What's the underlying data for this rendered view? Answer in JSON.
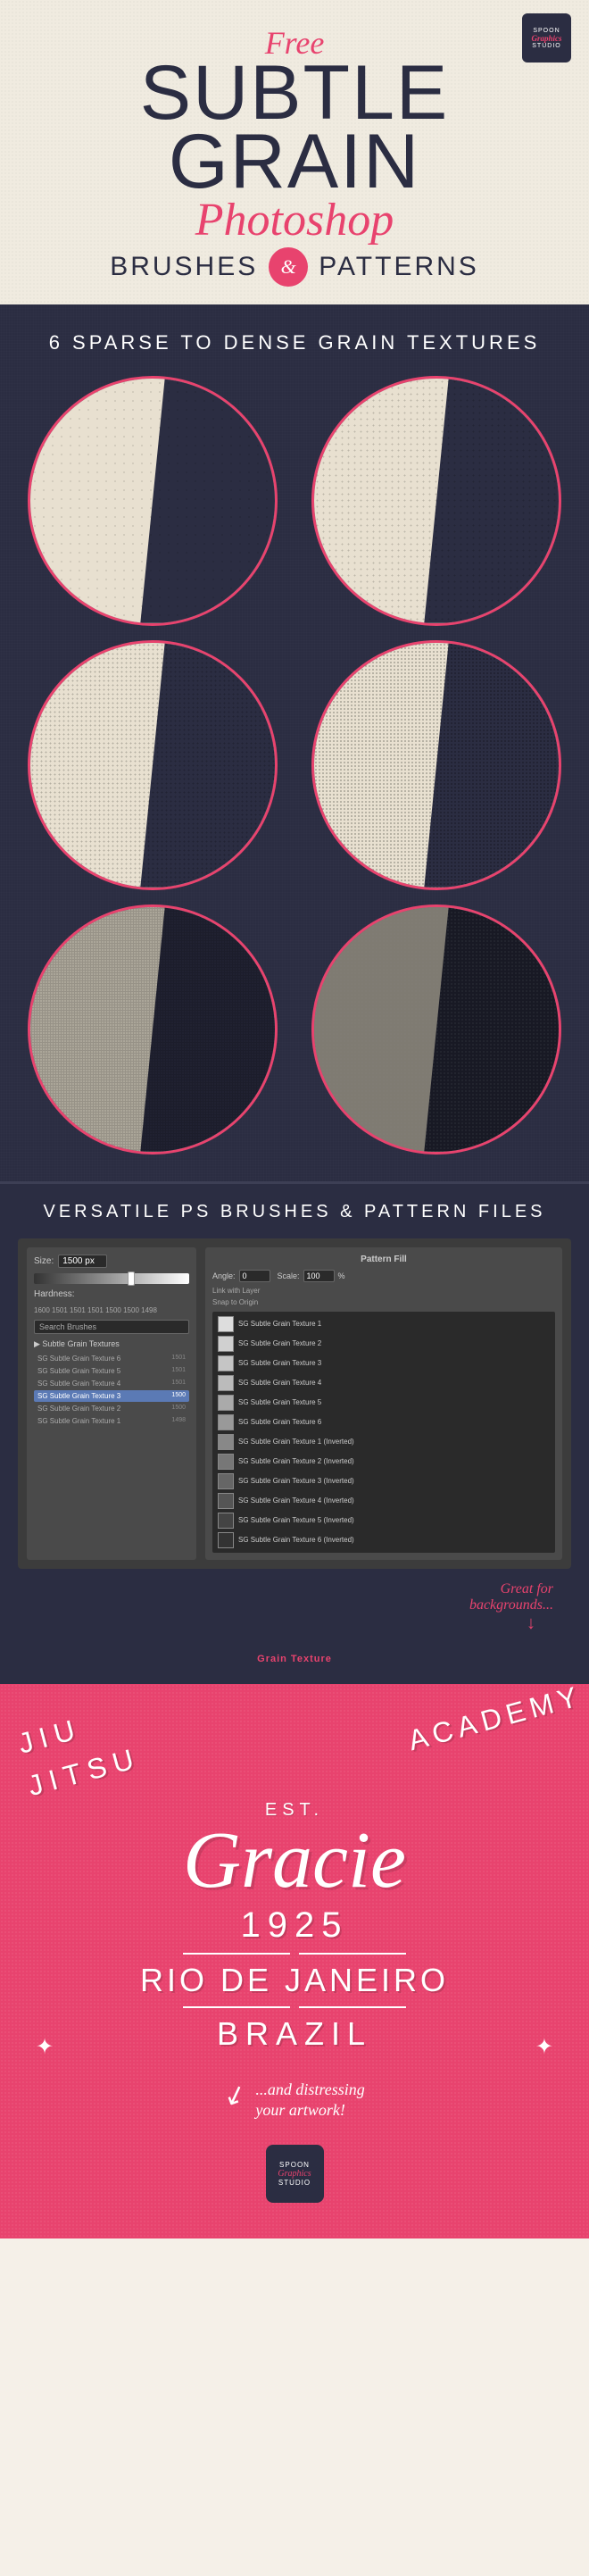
{
  "header": {
    "free_label": "Free",
    "subtle_label": "SUBTLE",
    "grain_label": "GRAIN",
    "photoshop_label": "Photoshop",
    "brushes_label": "BRUSHES",
    "ampersand_label": "&",
    "patterns_label": "PATTERNS",
    "spoon_line1": "SPOON",
    "spoon_line2": "Graphics",
    "spoon_line3": "STUDIO"
  },
  "grain_section": {
    "title": "6 SPARSE TO DENSE GRAIN TEXTURES"
  },
  "versatile_section": {
    "title": "VERSATILE PS BRUSHES & PATTERN FILES",
    "size_label": "Size:",
    "size_value": "1500 px",
    "hardness_label": "Hardness:",
    "numbers_row": "1600 1501 1501 1501 1500 1500 1498",
    "search_placeholder": "Search Brushes",
    "folder_label": "▶ Subtle Grain Textures",
    "brushes": [
      "SG Subtle Grain Texture 6",
      "SG Subtle Grain Texture 5",
      "SG Subtle Grain Texture 4",
      "SG Subtle Grain Texture 3",
      "SG Subtle Grain Texture 2",
      "SG Subtle Grain Texture 1"
    ],
    "brush_sizes": [
      "1501",
      "1501",
      "1501",
      "1500",
      "1500",
      "1498"
    ],
    "pattern_fill_title": "Pattern Fill",
    "angle_label": "Angle:",
    "angle_value": "0",
    "scale_label": "Scale:",
    "scale_value": "100",
    "scale_unit": "%",
    "link_label": "Link with Layer",
    "snap_label": "Snap to Origin",
    "patterns": [
      "SG Subtle Grain Texture 1",
      "SG Subtle Grain Texture 2",
      "SG Subtle Grain Texture 3",
      "SG Subtle Grain Texture 4",
      "SG Subtle Grain Texture 5",
      "SG Subtle Grain Texture 6",
      "SG Subtle Grain Texture 1 (Inverted)",
      "SG Subtle Grain Texture 2 (Inverted)",
      "SG Subtle Grain Texture 3 (Inverted)",
      "SG Subtle Grain Texture 4 (Inverted)",
      "SG Subtle Grain Texture 5 (Inverted)",
      "SG Subtle Grain Texture 6 (Inverted)"
    ],
    "great_for_note": "Great for\nbackgrounds...",
    "grain_texture_label": "Grain Texture"
  },
  "red_section": {
    "jiu_label": "JIU",
    "jitsu_label": "JITSU",
    "academy_label": "ACADEMY",
    "est_label": "EST.",
    "gracie_label": "Gracie",
    "year_label": "1925",
    "rio_label": "RIO DE JANEIRO",
    "brazil_label": "BRAZIL",
    "distressing_note": "...and distressing\nyour artwork!",
    "spoon_line1": "SPOON",
    "spoon_line2": "Graphics",
    "spoon_line3": "STUDIO"
  }
}
